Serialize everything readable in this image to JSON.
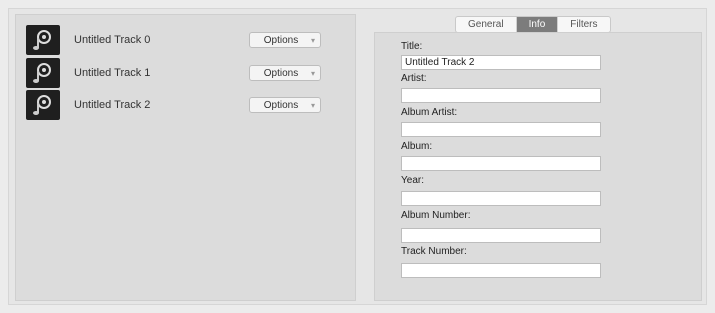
{
  "tracks": [
    {
      "name": "Untitled Track 0",
      "options_label": "Options",
      "icon": "music-file-icon"
    },
    {
      "name": "Untitled Track 1",
      "options_label": "Options",
      "icon": "music-file-icon"
    },
    {
      "name": "Untitled Track 2",
      "options_label": "Options",
      "icon": "music-file-icon"
    }
  ],
  "tabs": [
    {
      "label": "General",
      "active": false
    },
    {
      "label": "Info",
      "active": true
    },
    {
      "label": "Filters",
      "active": false
    }
  ],
  "info_fields": [
    {
      "label": "Title:",
      "value": "Untitled Track 2"
    },
    {
      "label": "Artist:",
      "value": ""
    },
    {
      "label": "Album Artist:",
      "value": ""
    },
    {
      "label": "Album:",
      "value": ""
    },
    {
      "label": "Year:",
      "value": ""
    },
    {
      "label": "Album Number:",
      "value": ""
    },
    {
      "label": "Track Number:",
      "value": ""
    }
  ]
}
